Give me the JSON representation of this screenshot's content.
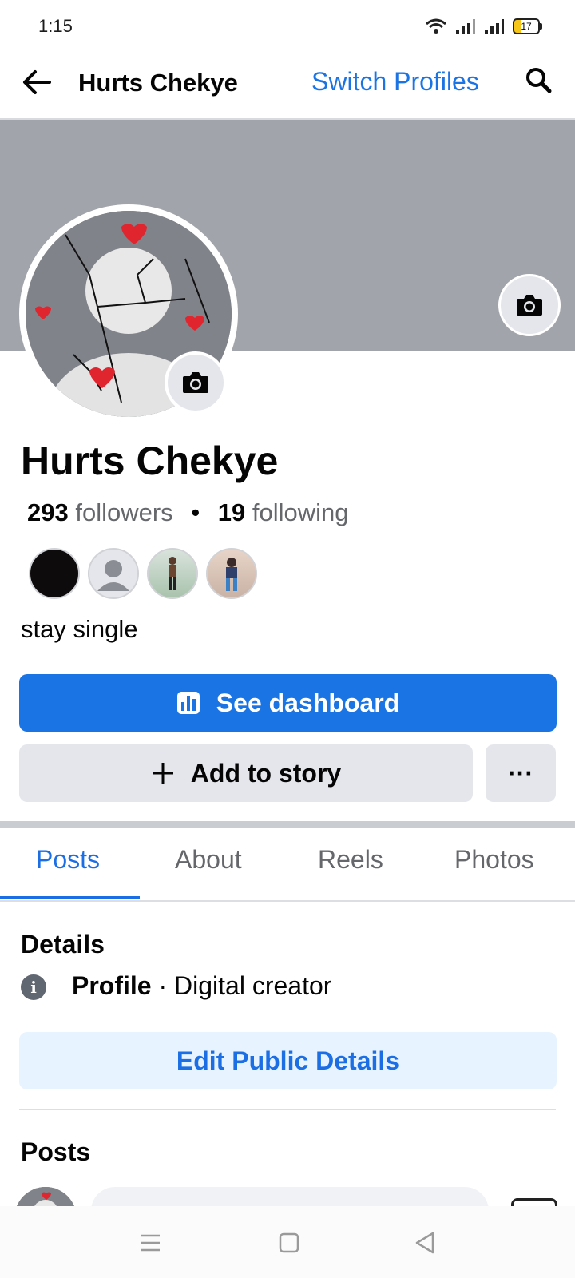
{
  "status_bar": {
    "time": "1:15",
    "battery": "17"
  },
  "header": {
    "title": "Hurts Chekye",
    "switch_profiles": "Switch Profiles"
  },
  "profile": {
    "name": "Hurts Chekye",
    "followers_count": "293",
    "followers_label": "followers",
    "following_count": "19",
    "following_label": "following",
    "bio": "stay single"
  },
  "buttons": {
    "dashboard": "See dashboard",
    "add_story": "Add to story",
    "more": "···",
    "edit_details": "Edit Public Details"
  },
  "tabs": [
    {
      "label": "Posts",
      "active": true
    },
    {
      "label": "About"
    },
    {
      "label": "Reels"
    },
    {
      "label": "Photos"
    }
  ],
  "details": {
    "heading": "Details",
    "type_label": "Profile",
    "type_value": "· Digital creator"
  },
  "posts": {
    "heading": "Posts"
  },
  "colors": {
    "accent": "#1b74e4",
    "cover": "#a1a4aa",
    "button_gray": "#e4e6eb"
  }
}
